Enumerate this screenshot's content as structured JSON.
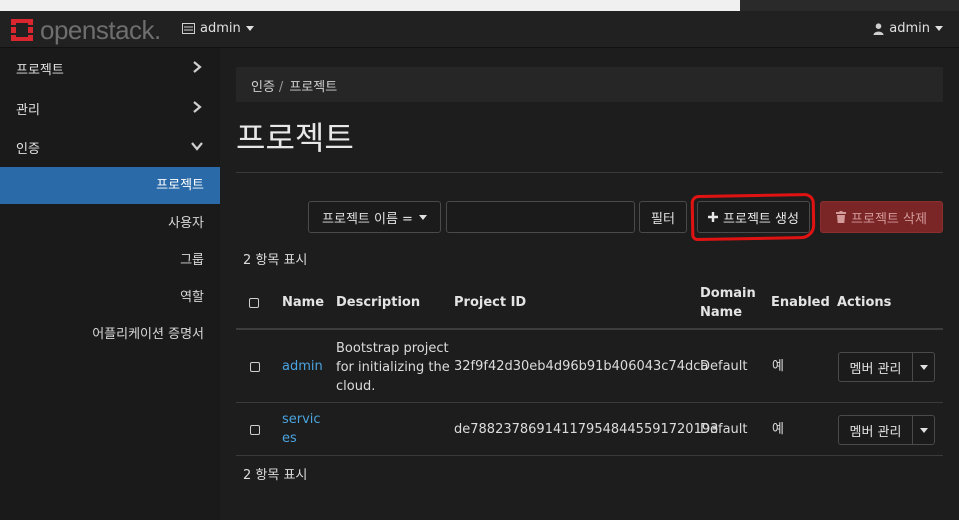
{
  "brand": {
    "name": "openstack."
  },
  "navbar": {
    "project_label": "admin",
    "user_label": "admin"
  },
  "sidebar": {
    "items": [
      {
        "label": "프로젝트"
      },
      {
        "label": "관리"
      },
      {
        "label": "인증"
      }
    ],
    "sub_items": [
      {
        "label": "프로젝트",
        "active": true
      },
      {
        "label": "사용자"
      },
      {
        "label": "그룹"
      },
      {
        "label": "역할"
      },
      {
        "label": "어플리케이션 증명서"
      }
    ]
  },
  "breadcrumb": {
    "parent": "인증",
    "separator": "/",
    "current": "프로젝트"
  },
  "page": {
    "title": "프로젝트"
  },
  "toolbar": {
    "filter_field": "프로젝트 이름 =",
    "filter_input_value": "",
    "filter_button": "필터",
    "create_button": "프로젝트 생성",
    "delete_button": "프로젝트 삭제"
  },
  "table": {
    "count_top": "2 항목 표시",
    "count_bottom": "2 항목 표시",
    "columns": {
      "name": "Name",
      "description": "Description",
      "project_id": "Project ID",
      "domain_line1": "Domain",
      "domain_line2": "Name",
      "enabled": "Enabled",
      "actions": "Actions"
    },
    "rows": [
      {
        "name": "admin",
        "desc_line1": "Bootstrap project",
        "desc_line2": "for initializing the",
        "desc_line3": "cloud.",
        "project_id": "32f9f42d30eb4d96b91b406043c74dca",
        "domain": "Default",
        "enabled": "예",
        "action": "멤버 관리"
      },
      {
        "name_line1": "servic",
        "name_line2": "es",
        "project_id": "de788237869141179548445591720193",
        "domain": "Default",
        "enabled": "예",
        "action": "멤버 관리"
      }
    ]
  },
  "colors": {
    "accent_active": "#2a6aa8",
    "link": "#4aa3df",
    "danger": "#7a2626",
    "annotation": "#e01212",
    "logo": "#d9262f"
  },
  "icons": {
    "navbar_project": "server-icon",
    "navbar_user": "user-icon",
    "create": "plus-icon",
    "delete": "trash-icon",
    "sidebar_collapsed": "chevron-right-icon",
    "sidebar_expanded": "chevron-down-icon"
  }
}
